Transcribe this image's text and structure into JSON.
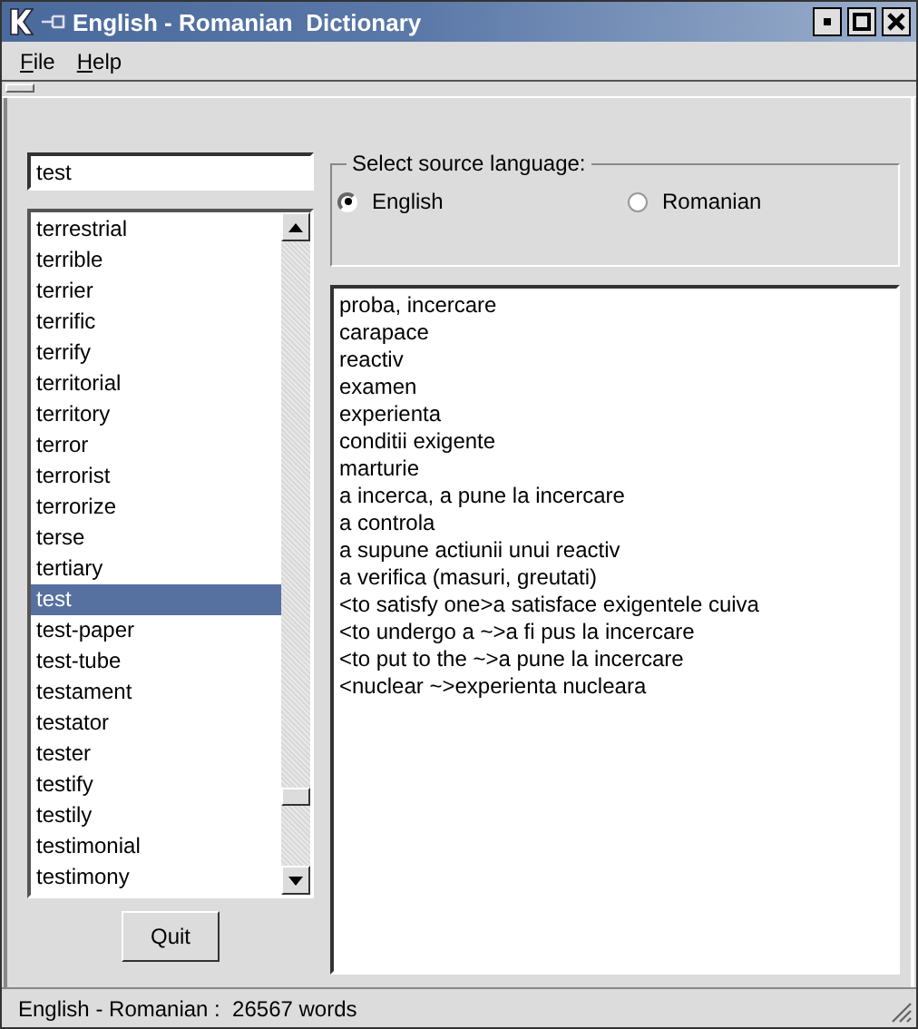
{
  "window": {
    "title": "English - Romanian  Dictionary"
  },
  "menu": [
    {
      "label": "File"
    },
    {
      "label": "Help"
    }
  ],
  "search": {
    "value": "test"
  },
  "words": [
    {
      "label": "terrestrial",
      "selected": false
    },
    {
      "label": "terrible",
      "selected": false
    },
    {
      "label": "terrier",
      "selected": false
    },
    {
      "label": "terrific",
      "selected": false
    },
    {
      "label": "terrify",
      "selected": false
    },
    {
      "label": "territorial",
      "selected": false
    },
    {
      "label": "territory",
      "selected": false
    },
    {
      "label": "terror",
      "selected": false
    },
    {
      "label": "terrorist",
      "selected": false
    },
    {
      "label": "terrorize",
      "selected": false
    },
    {
      "label": "terse",
      "selected": false
    },
    {
      "label": "tertiary",
      "selected": false
    },
    {
      "label": "test",
      "selected": true
    },
    {
      "label": "test-paper",
      "selected": false
    },
    {
      "label": "test-tube",
      "selected": false
    },
    {
      "label": "testament",
      "selected": false
    },
    {
      "label": "testator",
      "selected": false
    },
    {
      "label": "tester",
      "selected": false
    },
    {
      "label": "testify",
      "selected": false
    },
    {
      "label": "testily",
      "selected": false
    },
    {
      "label": "testimonial",
      "selected": false
    },
    {
      "label": "testimony",
      "selected": false
    }
  ],
  "source_language": {
    "label": "Select source language:",
    "options": [
      {
        "label": "English",
        "selected": true
      },
      {
        "label": "Romanian",
        "selected": false
      }
    ]
  },
  "translations": [
    "proba, incercare",
    "carapace",
    "reactiv",
    "examen",
    "experienta",
    "conditii exigente",
    "marturie",
    "a incerca, a pune la incercare",
    "a controla",
    "a supune actiunii unui reactiv",
    "a verifica (masuri, greutati)",
    "<to satisfy one>a satisface exigentele cuiva",
    "<to undergo a ~>a fi pus la incercare",
    "<to put to the ~>a pune la incercare",
    "<nuclear ~>experienta nucleara"
  ],
  "quit_button": "Quit",
  "status_bar": "English - Romanian :  26567 words"
}
